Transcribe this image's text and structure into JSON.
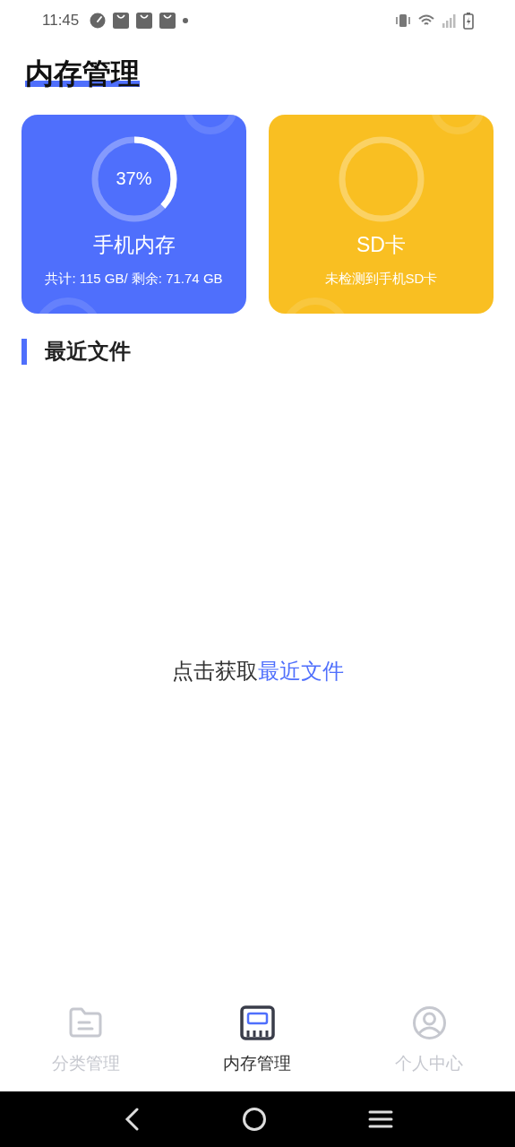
{
  "status_bar": {
    "time": "11:45"
  },
  "title": "内存管理",
  "cards": [
    {
      "kind": "phone",
      "color": "#4f6ffc",
      "percent": "37%",
      "level": 0.37,
      "name": "手机内存",
      "detail": "共计: 115 GB/ 剩余: 71.74 GB"
    },
    {
      "kind": "sd",
      "color": "#f9bf22",
      "name": "SD卡",
      "detail": "未检测到手机SD卡"
    }
  ],
  "section_title": "最近文件",
  "empty_state": {
    "text": "点击获取",
    "link": "最近文件"
  },
  "tabs": [
    {
      "kind": "category",
      "label": "分类管理",
      "selected": false
    },
    {
      "kind": "storage",
      "label": "内存管理",
      "selected": true
    },
    {
      "kind": "profile",
      "label": "个人中心",
      "selected": false
    }
  ]
}
